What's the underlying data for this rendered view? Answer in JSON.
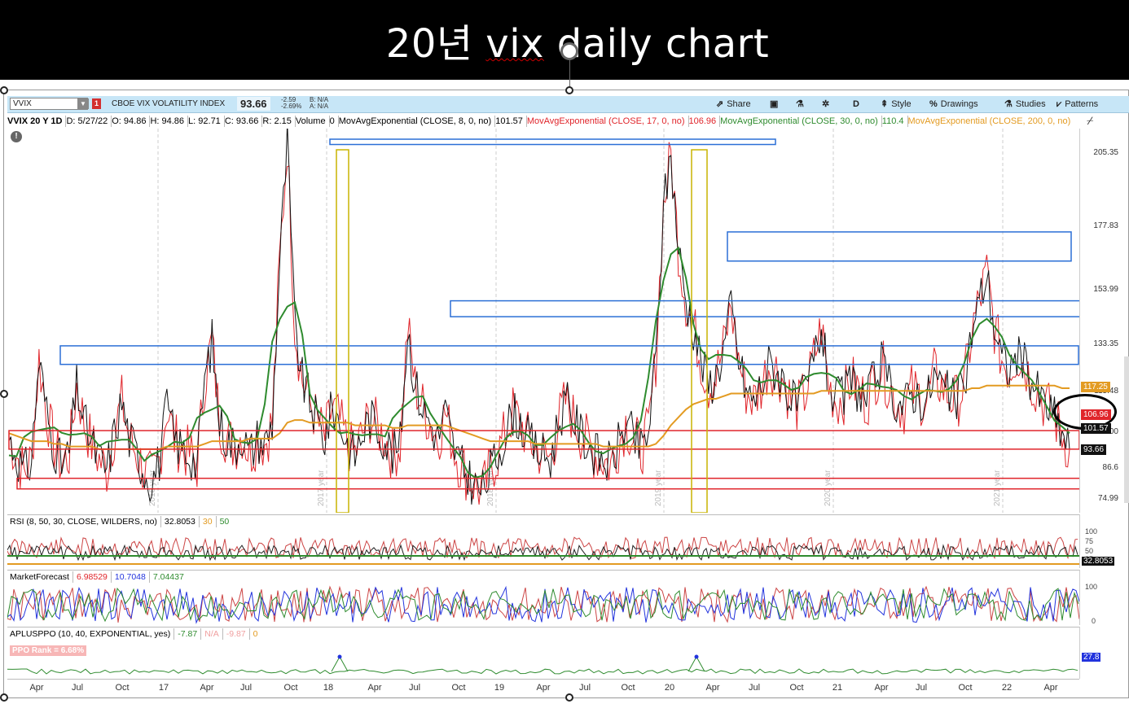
{
  "page_title": {
    "number": "20",
    "korean": "년",
    "rest_a": "vix",
    "rest_b": "daily chart"
  },
  "toolbar": {
    "symbol": "VVIX",
    "flag": "1",
    "instrument_name": "CBOE VIX VOLATILITY INDEX",
    "last_price": "93.66",
    "change": "-2.59",
    "change_pct": "-2.69%",
    "bid": "B: N/A",
    "ask": "A: N/A",
    "share": "Share",
    "aggregation": "D",
    "style": "Style",
    "drawings": "Drawings",
    "studies": "Studies",
    "patterns": "Patterns"
  },
  "legend": {
    "ohlc": "VVIX 20 Y 1D",
    "date": "D: 5/27/22",
    "open": "O: 94.86",
    "high": "H: 94.86",
    "low": "L: 92.71",
    "close": "C: 93.66",
    "range": "R: 2.15",
    "volume_label": "Volume",
    "volume_value": "0",
    "ema8": "MovAvgExponential (CLOSE, 8, 0, no)",
    "ema8_val": "101.57",
    "ema17": "MovAvgExponential (CLOSE, 17, 0, no)",
    "ema17_val": "106.96",
    "ema30": "MovAvgExponential (CLOSE, 30, 0, no)",
    "ema30_val": "110.4",
    "ema200": "MovAvgExponential (CLOSE, 200, 0, no)"
  },
  "rsi": {
    "label": "RSI (8, 50, 30, CLOSE, WILDERS, no)",
    "value": "32.8053",
    "oversold": "30",
    "mid": "50",
    "axis": [
      "100",
      "75",
      "50",
      "25"
    ],
    "tag": "32.8053"
  },
  "market_forecast": {
    "label": "MarketForecast",
    "v1": "6.98529",
    "v2": "10.7048",
    "v3": "7.04437",
    "axis": [
      "100",
      "0"
    ]
  },
  "ppo": {
    "label": "APLUSPPO (10, 40, EXPONENTIAL, yes)",
    "v1": "-7.87",
    "v2": "N/A",
    "v3": "-9.87",
    "v4": "0",
    "rank": "PPO Rank = 6.68%",
    "tag": "27.8"
  },
  "colors": {
    "ema8": "#111111",
    "ema17": "#e0252b",
    "ema30": "#2e8b2e",
    "ema200": "#e39b22",
    "blue_box": "#2b6fd6",
    "red_box": "#e0252b",
    "yellow_box": "#c9b400"
  },
  "chart_data": {
    "type": "line",
    "title": "",
    "ylabel": "",
    "y_ticks": [
      "205.35",
      "177.83",
      "153.99",
      "133.35",
      "115.48",
      "100",
      "86.6",
      "74.99"
    ],
    "ylim": [
      70,
      215
    ],
    "x_ticks": [
      "Apr",
      "Jul",
      "Oct",
      "17",
      "Apr",
      "Jul",
      "Oct",
      "18",
      "Apr",
      "Jul",
      "Oct",
      "19",
      "Apr",
      "Jul",
      "Oct",
      "20",
      "Apr",
      "Jul",
      "Oct",
      "21",
      "Apr",
      "Jul",
      "Oct",
      "22",
      "Apr"
    ],
    "year_watermarks": [
      "2016 year",
      "2017 year",
      "2018 year",
      "2019 year",
      "2020 year",
      "2021 year"
    ],
    "price_tags": [
      {
        "value": "117.25",
        "color": "#e39b22"
      },
      {
        "value": "106.96",
        "color": "#e0252b"
      },
      {
        "value": "101.57",
        "color": "#111111"
      },
      {
        "value": "93.66",
        "color": "#111111"
      }
    ],
    "series": [
      {
        "name": "VVIX daily",
        "values": [
          98,
          92,
          85,
          90,
          128,
          108,
          95,
          88,
          92,
          118,
          104,
          96,
          90,
          86,
          100,
          112,
          98,
          92,
          86,
          82,
          90,
          110,
          98,
          94,
          92,
          88,
          120,
          135,
          104,
          98,
          95,
          100,
          92,
          98,
          96,
          104,
          165,
          210,
          140,
          120,
          112,
          104,
          98,
          110,
          104,
          96,
          92,
          100,
          106,
          102,
          98,
          92,
          96,
          140,
          118,
          110,
          104,
          98,
          108,
          96,
          88,
          84,
          80,
          78,
          86,
          92,
          100,
          108,
          104,
          98,
          94,
          92,
          90,
          104,
          112,
          106,
          100,
          96,
          92,
          90,
          88,
          96,
          104,
          98,
          94,
          100,
          128,
          185,
          205,
          170,
          150,
          140,
          128,
          118,
          122,
          132,
          148,
          128,
          116,
          112,
          118,
          126,
          124,
          120,
          112,
          110,
          116,
          128,
          140,
          118,
          112,
          114,
          120,
          116,
          112,
          120,
          126,
          118,
          112,
          110,
          116,
          114,
          112,
          122,
          118,
          114,
          112,
          118,
          138,
          150,
          160,
          140,
          128,
          124,
          130,
          126,
          120,
          114,
          110,
          106,
          100,
          94
        ]
      },
      {
        "name": "EMA 200",
        "values": [
          100,
          99,
          98,
          97,
          97,
          97,
          96,
          96,
          95,
          95,
          95,
          95,
          94,
          94,
          94,
          94,
          94,
          94,
          94,
          94,
          94,
          95,
          95,
          95,
          95,
          95,
          96,
          97,
          97,
          97,
          97,
          97,
          98,
          98,
          98,
          98,
          100,
          104,
          105,
          105,
          104,
          104,
          104,
          104,
          104,
          104,
          103,
          103,
          103,
          103,
          103,
          102,
          102,
          103,
          103,
          103,
          103,
          103,
          103,
          102,
          101,
          100,
          99,
          98,
          97,
          97,
          97,
          97,
          97,
          97,
          96,
          96,
          96,
          96,
          96,
          96,
          96,
          96,
          96,
          95,
          95,
          95,
          95,
          95,
          95,
          95,
          96,
          99,
          103,
          106,
          109,
          111,
          112,
          113,
          113,
          114,
          115,
          115,
          115,
          115,
          115,
          115,
          115,
          115,
          115,
          115,
          115,
          115,
          116,
          116,
          116,
          116,
          116,
          116,
          116,
          116,
          116,
          116,
          116,
          116,
          116,
          116,
          116,
          116,
          116,
          116,
          116,
          116,
          117,
          117,
          118,
          118,
          118,
          118,
          118,
          118,
          118,
          118,
          118,
          118,
          117,
          117
        ]
      }
    ],
    "boxes": {
      "blue_resistance": [
        "205.35 area (2018 & 2020 peaks)",
        "2020-21 highs",
        "~150 zone",
        "~133 zone"
      ],
      "red_support": [
        "~100-93 zone",
        "~80 zone"
      ],
      "yellow_spikes": [
        "Feb 2018",
        "Mar 2020"
      ]
    }
  }
}
